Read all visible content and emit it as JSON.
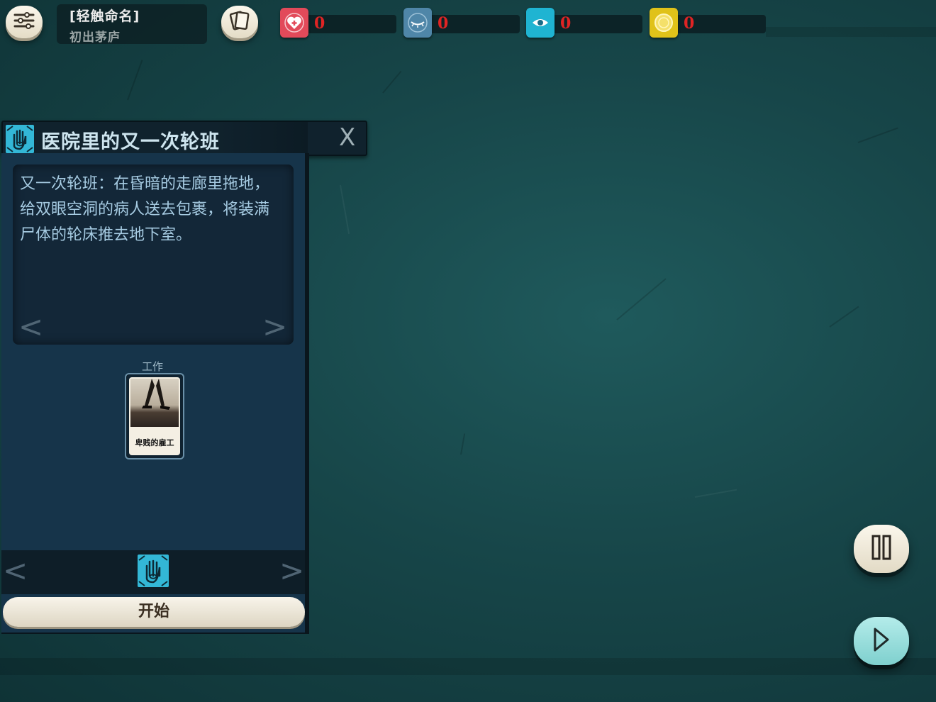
{
  "legacy": {
    "title": "[轻触命名]",
    "subtitle": "初出茅庐"
  },
  "top_buttons": {
    "options_icon": "sliders-icon",
    "deck_icon": "cards-icon"
  },
  "stats": [
    {
      "key": "health",
      "icon": "heart-icon",
      "color": "#e24a5a",
      "value": "0"
    },
    {
      "key": "rest",
      "icon": "closed-eye-icon",
      "color": "#4f86a8",
      "value": "0"
    },
    {
      "key": "reason",
      "icon": "eye-icon",
      "color": "#1fb4d2",
      "value": "0"
    },
    {
      "key": "funds",
      "icon": "coin-icon",
      "color": "#e0c219",
      "value": "0"
    }
  ],
  "verb_panel": {
    "title": "医院里的又一次轮班",
    "close_label": "X",
    "description": "又一次轮班：在昏暗的走廊里拖地，给双眼空洞的病人送去包裹，将装满尸体的轮床推去地下室。",
    "prev_arrow": "<",
    "next_arrow": ">",
    "slot_label": "工作",
    "card_label": "卑贱的雇工",
    "start_label": "开始"
  },
  "controls": {
    "pause_icon": "pause-icon",
    "play_icon": "play-icon"
  }
}
